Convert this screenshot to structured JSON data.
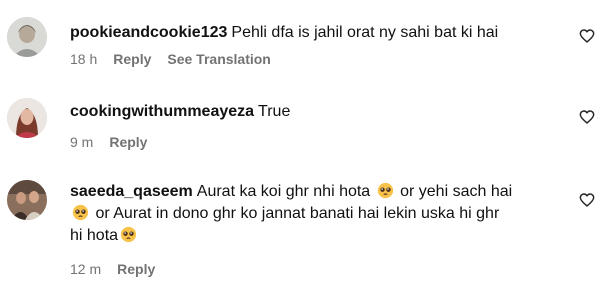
{
  "comments": [
    {
      "username": "pookieandcookie123",
      "text": "Pehli dfa is jahil orat ny sahi bat ki hai",
      "time": "18 h",
      "reply_label": "Reply",
      "see_translation_label": "See Translation"
    },
    {
      "username": "cookingwithummeayeza",
      "text": "True",
      "time": "9 m",
      "reply_label": "Reply"
    },
    {
      "username": "saeeda_qaseem",
      "text_part1": "Aurat ka koi ghr nhi hota",
      "text_part2": "or yehi sach hai",
      "text_part3": "or Aurat in dono ghr ko jannat banati hai lekin uska hi ghr",
      "text_part4": "hi hota",
      "time": "12 m",
      "reply_label": "Reply"
    }
  ],
  "icons": {
    "like": "heart-outline-icon",
    "emoji": "pleading-face-emoji"
  },
  "colors": {
    "meta_text": "#737373",
    "text": "#111111"
  }
}
